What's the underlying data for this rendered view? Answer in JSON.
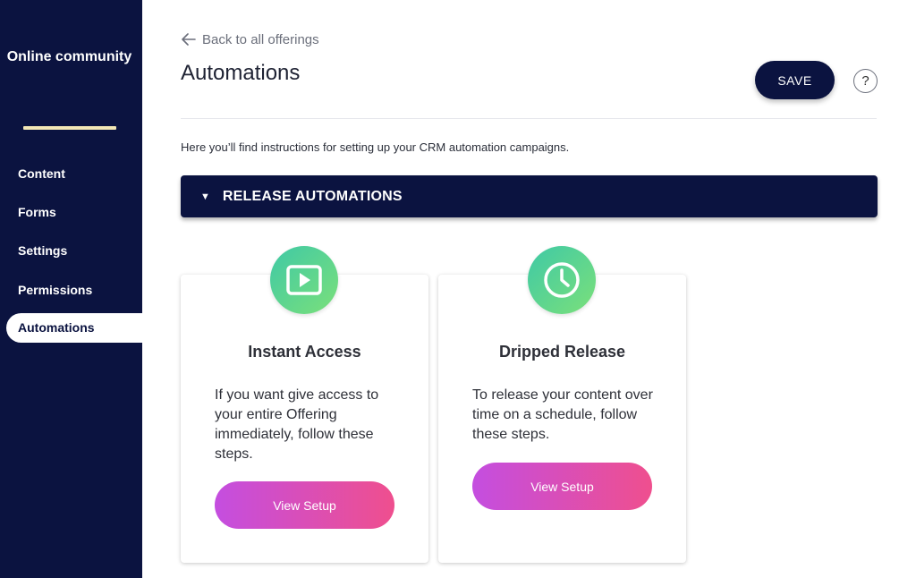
{
  "sidebar": {
    "brand": "Online community",
    "items": [
      {
        "label": "Content",
        "active": false
      },
      {
        "label": "Forms",
        "active": false
      },
      {
        "label": "Settings",
        "active": false
      },
      {
        "label": "Permissions",
        "active": false
      },
      {
        "label": "Automations",
        "active": true
      }
    ]
  },
  "header": {
    "back_label": "Back to all offerings",
    "title": "Automations",
    "save_label": "SAVE",
    "help_label": "?"
  },
  "intro": "Here you’ll find instructions for setting up your CRM automation campaigns.",
  "section": {
    "title": "RELEASE AUTOMATIONS",
    "expanded": true
  },
  "cards": [
    {
      "icon": "play-icon",
      "title": "Instant Access",
      "description": "If you want give access to your entire Offering immediately, follow these steps.",
      "button_label": "View Setup"
    },
    {
      "icon": "clock-icon",
      "title": "Dripped Release",
      "description": "To release your content over time on a schedule, follow these steps.",
      "button_label": "View Setup"
    }
  ],
  "colors": {
    "navy": "#0b1340",
    "brand_underline": "#f3e7b6",
    "icon_gradient_start": "#3fc9a6",
    "icon_gradient_end": "#7be07a",
    "button_gradient_start": "#c44ee0",
    "button_gradient_end": "#ef4f8e"
  }
}
